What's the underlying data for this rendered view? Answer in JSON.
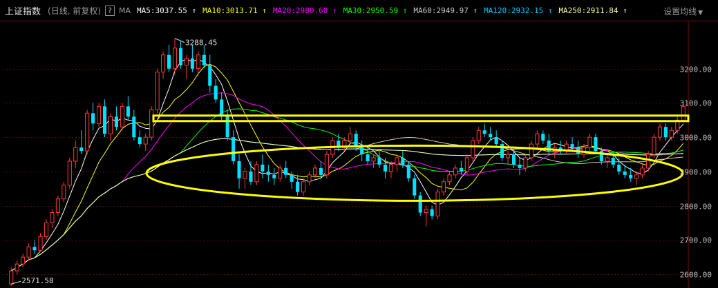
{
  "header": {
    "title": "上证指数",
    "subtitle": "(日线, 前复权)",
    "help": "?",
    "indicator": "MA",
    "ma": [
      {
        "label": "MA5",
        "value": "3037.55",
        "color": "#ffffff"
      },
      {
        "label": "MA10",
        "value": "3013.71",
        "color": "#ffff00"
      },
      {
        "label": "MA20",
        "value": "2980.60",
        "color": "#ff00ff"
      },
      {
        "label": "MA30",
        "value": "2950.59",
        "color": "#00ff00"
      },
      {
        "label": "MA60",
        "value": "2949.97",
        "color": "#cccccc"
      },
      {
        "label": "MA120",
        "value": "2932.15",
        "color": "#00ccff"
      },
      {
        "label": "MA250",
        "value": "2911.84",
        "color": "#ffffaa"
      }
    ],
    "settings_label": "设置均线"
  },
  "chart_data": {
    "type": "candlestick",
    "y_ticks": [
      "3200.00",
      "3100.00",
      "3000.00",
      "2900.00",
      "2800.00",
      "2700.00",
      "2600.00"
    ],
    "ylim": [
      2560,
      3340
    ],
    "annotations": {
      "high": "3288.45",
      "low": "2571.58"
    },
    "high_value": 3288.45,
    "low_value": 2571.58,
    "resistance_level": 3055,
    "up_color": "#ff3b3b",
    "down_color": "#00e0ff",
    "overlay_color": "#ffff00",
    "candles": [
      [
        2571.58,
        2620,
        2565,
        2610
      ],
      [
        2610,
        2640,
        2600,
        2630
      ],
      [
        2630,
        2660,
        2620,
        2650
      ],
      [
        2650,
        2690,
        2640,
        2680
      ],
      [
        2680,
        2700,
        2660,
        2670
      ],
      [
        2670,
        2720,
        2665,
        2710
      ],
      [
        2710,
        2760,
        2700,
        2750
      ],
      [
        2750,
        2790,
        2735,
        2780
      ],
      [
        2780,
        2830,
        2770,
        2820
      ],
      [
        2820,
        2870,
        2810,
        2860
      ],
      [
        2860,
        2940,
        2850,
        2930
      ],
      [
        2930,
        2990,
        2910,
        2970
      ],
      [
        2970,
        3020,
        2950,
        2960
      ],
      [
        2960,
        3080,
        2950,
        3070
      ],
      [
        3070,
        3100,
        3020,
        3040
      ],
      [
        3040,
        3100,
        3030,
        3090
      ],
      [
        3090,
        3110,
        3000,
        3010
      ],
      [
        3010,
        3070,
        2990,
        3060
      ],
      [
        3060,
        3090,
        3020,
        3030
      ],
      [
        3030,
        3100,
        3020,
        3090
      ],
      [
        3090,
        3120,
        3050,
        3060
      ],
      [
        3060,
        3080,
        2990,
        3000
      ],
      [
        3000,
        3020,
        2970,
        2980
      ],
      [
        2980,
        3010,
        2960,
        3000
      ],
      [
        3000,
        3090,
        2990,
        3080
      ],
      [
        3080,
        3200,
        3070,
        3190
      ],
      [
        3190,
        3250,
        3170,
        3240
      ],
      [
        3240,
        3270,
        3190,
        3200
      ],
      [
        3200,
        3288.45,
        3180,
        3260
      ],
      [
        3260,
        3280,
        3200,
        3210
      ],
      [
        3210,
        3240,
        3170,
        3230
      ],
      [
        3230,
        3270,
        3190,
        3200
      ],
      [
        3200,
        3250,
        3180,
        3240
      ],
      [
        3240,
        3270,
        3200,
        3210
      ],
      [
        3210,
        3240,
        3130,
        3150
      ],
      [
        3150,
        3170,
        3100,
        3110
      ],
      [
        3110,
        3130,
        3050,
        3060
      ],
      [
        3060,
        3080,
        2990,
        3000
      ],
      [
        3000,
        3020,
        2920,
        2930
      ],
      [
        2930,
        2950,
        2850,
        2880
      ],
      [
        2880,
        2910,
        2850,
        2900
      ],
      [
        2900,
        2930,
        2860,
        2870
      ],
      [
        2870,
        2930,
        2860,
        2920
      ],
      [
        2920,
        2950,
        2880,
        2900
      ],
      [
        2900,
        2920,
        2870,
        2890
      ],
      [
        2890,
        2910,
        2860,
        2880
      ],
      [
        2880,
        2920,
        2870,
        2910
      ],
      [
        2910,
        2930,
        2880,
        2890
      ],
      [
        2890,
        2900,
        2850,
        2870
      ],
      [
        2870,
        2890,
        2830,
        2840
      ],
      [
        2840,
        2880,
        2830,
        2870
      ],
      [
        2870,
        2900,
        2860,
        2890
      ],
      [
        2890,
        2920,
        2880,
        2910
      ],
      [
        2910,
        2930,
        2880,
        2890
      ],
      [
        2890,
        2960,
        2880,
        2950
      ],
      [
        2950,
        3000,
        2940,
        2990
      ],
      [
        2990,
        3010,
        2960,
        2970
      ],
      [
        2970,
        3000,
        2960,
        2990
      ],
      [
        2990,
        3030,
        2980,
        3010
      ],
      [
        3010,
        3020,
        2960,
        2970
      ],
      [
        2970,
        2990,
        2930,
        2950
      ],
      [
        2950,
        2970,
        2920,
        2930
      ],
      [
        2930,
        2950,
        2910,
        2940
      ],
      [
        2940,
        2960,
        2910,
        2920
      ],
      [
        2920,
        2940,
        2880,
        2900
      ],
      [
        2900,
        2930,
        2880,
        2920
      ],
      [
        2920,
        2950,
        2900,
        2940
      ],
      [
        2940,
        2960,
        2910,
        2920
      ],
      [
        2920,
        2930,
        2870,
        2880
      ],
      [
        2880,
        2890,
        2820,
        2830
      ],
      [
        2830,
        2840,
        2770,
        2780
      ],
      [
        2780,
        2800,
        2740,
        2790
      ],
      [
        2790,
        2800,
        2760,
        2770
      ],
      [
        2770,
        2850,
        2760,
        2840
      ],
      [
        2840,
        2880,
        2830,
        2870
      ],
      [
        2870,
        2900,
        2860,
        2890
      ],
      [
        2890,
        2920,
        2880,
        2910
      ],
      [
        2910,
        2930,
        2890,
        2900
      ],
      [
        2900,
        2950,
        2890,
        2940
      ],
      [
        2940,
        3000,
        2930,
        2990
      ],
      [
        2990,
        3030,
        2980,
        3020
      ],
      [
        3020,
        3040,
        3000,
        3010
      ],
      [
        3010,
        3030,
        2990,
        3000
      ],
      [
        3000,
        3020,
        2970,
        2980
      ],
      [
        2980,
        2990,
        2930,
        2940
      ],
      [
        2940,
        2960,
        2920,
        2950
      ],
      [
        2950,
        2970,
        2910,
        2920
      ],
      [
        2920,
        2940,
        2890,
        2910
      ],
      [
        2910,
        2950,
        2900,
        2940
      ],
      [
        2940,
        2990,
        2930,
        2980
      ],
      [
        2980,
        3020,
        2970,
        3010
      ],
      [
        3010,
        3020,
        2980,
        2990
      ],
      [
        2990,
        3010,
        2950,
        2960
      ],
      [
        2960,
        2980,
        2940,
        2970
      ],
      [
        2970,
        2990,
        2950,
        2960
      ],
      [
        2960,
        2990,
        2950,
        2980
      ],
      [
        2980,
        3000,
        2960,
        2970
      ],
      [
        2970,
        2990,
        2940,
        2950
      ],
      [
        2950,
        2980,
        2940,
        2970
      ],
      [
        2970,
        3010,
        2960,
        3000
      ],
      [
        3000,
        3010,
        2950,
        2960
      ],
      [
        2960,
        2970,
        2920,
        2930
      ],
      [
        2930,
        2950,
        2910,
        2940
      ],
      [
        2940,
        2960,
        2910,
        2920
      ],
      [
        2920,
        2940,
        2890,
        2900
      ],
      [
        2900,
        2920,
        2880,
        2890
      ],
      [
        2890,
        2910,
        2870,
        2880
      ],
      [
        2880,
        2900,
        2860,
        2890
      ],
      [
        2890,
        2920,
        2880,
        2910
      ],
      [
        2910,
        2960,
        2900,
        2950
      ],
      [
        2950,
        3010,
        2940,
        3000
      ],
      [
        3000,
        3040,
        2990,
        3030
      ],
      [
        3030,
        3040,
        2990,
        3000
      ],
      [
        3000,
        3030,
        2990,
        3020
      ],
      [
        3020,
        3060,
        3010,
        3050
      ],
      [
        3050,
        3095,
        3040,
        3090
      ]
    ],
    "ma_series": [
      {
        "name": "MA5",
        "period": 5
      },
      {
        "name": "MA10",
        "period": 10
      },
      {
        "name": "MA20",
        "period": 20
      },
      {
        "name": "MA30",
        "period": 30
      },
      {
        "name": "MA60",
        "period": 60
      },
      {
        "name": "MA120",
        "period": 120
      },
      {
        "name": "MA250",
        "period": 250
      }
    ]
  }
}
